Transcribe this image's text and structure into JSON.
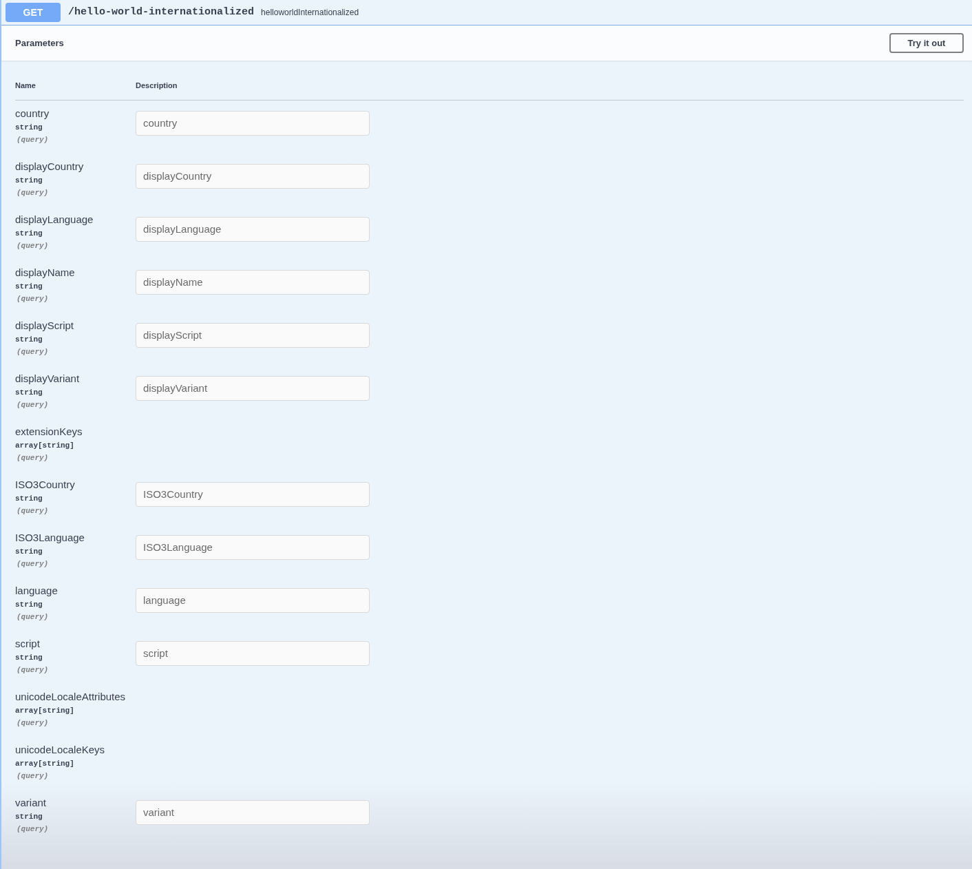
{
  "operation": {
    "method": "GET",
    "path": "/hello-world-internationalized",
    "operation_id": "helloworldInternationalized"
  },
  "parameters_section": {
    "title": "Parameters",
    "try_button": "Try it out"
  },
  "table": {
    "columns": [
      "Name",
      "Description"
    ],
    "rows": [
      {
        "name": "country",
        "type": "string",
        "location": "(query)",
        "kind": "input",
        "placeholder": "country"
      },
      {
        "name": "displayCountry",
        "type": "string",
        "location": "(query)",
        "kind": "input",
        "placeholder": "displayCountry"
      },
      {
        "name": "displayLanguage",
        "type": "string",
        "location": "(query)",
        "kind": "input",
        "placeholder": "displayLanguage"
      },
      {
        "name": "displayName",
        "type": "string",
        "location": "(query)",
        "kind": "input",
        "placeholder": "displayName"
      },
      {
        "name": "displayScript",
        "type": "string",
        "location": "(query)",
        "kind": "input",
        "placeholder": "displayScript"
      },
      {
        "name": "displayVariant",
        "type": "string",
        "location": "(query)",
        "kind": "input",
        "placeholder": "displayVariant"
      },
      {
        "name": "extensionKeys",
        "type": "array[string]",
        "location": "(query)",
        "kind": "array"
      },
      {
        "name": "ISO3Country",
        "type": "string",
        "location": "(query)",
        "kind": "input",
        "placeholder": "ISO3Country"
      },
      {
        "name": "ISO3Language",
        "type": "string",
        "location": "(query)",
        "kind": "input",
        "placeholder": "ISO3Language"
      },
      {
        "name": "language",
        "type": "string",
        "location": "(query)",
        "kind": "input",
        "placeholder": "language"
      },
      {
        "name": "script",
        "type": "string",
        "location": "(query)",
        "kind": "input",
        "placeholder": "script"
      },
      {
        "name": "unicodeLocaleAttributes",
        "type": "array[string]",
        "location": "(query)",
        "kind": "array"
      },
      {
        "name": "unicodeLocaleKeys",
        "type": "array[string]",
        "location": "(query)",
        "kind": "array"
      },
      {
        "name": "variant",
        "type": "string",
        "location": "(query)",
        "kind": "input",
        "placeholder": "variant"
      }
    ]
  }
}
